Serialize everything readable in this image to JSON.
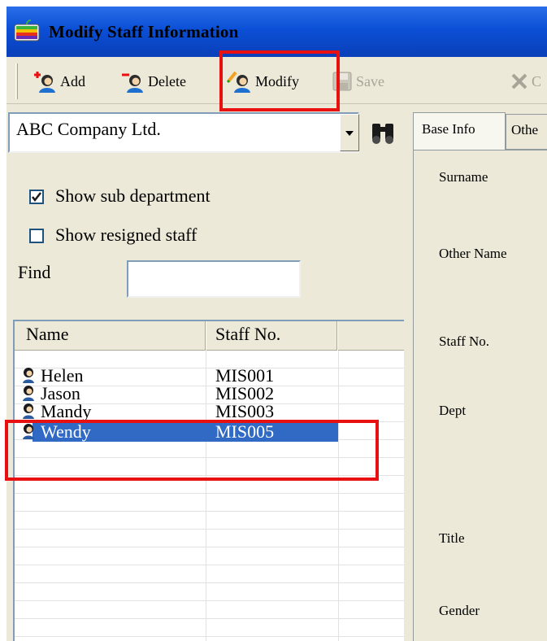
{
  "window": {
    "title": "Modify Staff Information"
  },
  "toolbar": {
    "add_label": "Add",
    "delete_label": "Delete",
    "modify_label": "Modify",
    "save_label": "Save",
    "cancel_label": "C"
  },
  "company": {
    "selected": "ABC Company Ltd."
  },
  "filters": {
    "show_sub_department": {
      "label": "Show sub department",
      "checked": true
    },
    "show_resigned_staff": {
      "label": "Show resigned staff",
      "checked": false
    },
    "find_label": "Find",
    "find_value": ""
  },
  "staff_list": {
    "columns": [
      "Name",
      "Staff No."
    ],
    "rows": [
      {
        "name": "Helen",
        "staff_no": "MIS001",
        "selected": false
      },
      {
        "name": "Jason",
        "staff_no": "MIS002",
        "selected": false
      },
      {
        "name": "Mandy",
        "staff_no": "MIS003",
        "selected": false
      },
      {
        "name": "Wendy",
        "staff_no": "MIS005",
        "selected": true
      }
    ]
  },
  "tabs": [
    {
      "label": "Base Info",
      "active": true
    },
    {
      "label": "Othe",
      "active": false
    }
  ],
  "fields": {
    "surname": "Surname",
    "other_name": "Other Name",
    "staff_no": "Staff No.",
    "dept": "Dept",
    "title": "Title",
    "gender": "Gender"
  },
  "colors": {
    "title_bar": "#0b4fd6",
    "selection": "#316ac5",
    "highlight_box": "#e81010",
    "window_bg": "#ece9d8"
  },
  "icons": [
    "app-icon",
    "add-staff-icon",
    "delete-staff-icon",
    "modify-staff-icon",
    "save-icon",
    "cancel-icon",
    "binoculars-icon",
    "staff-person-icon"
  ]
}
